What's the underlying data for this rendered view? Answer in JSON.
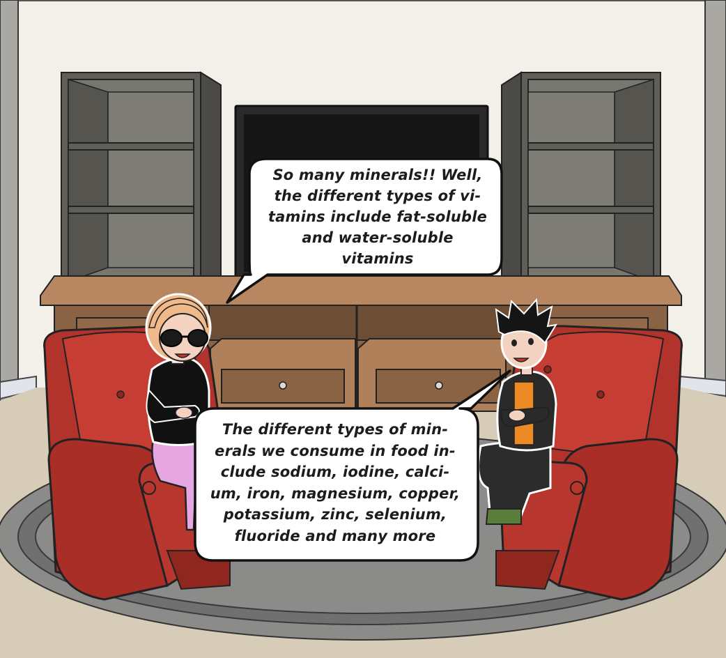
{
  "speech": {
    "top_bubble": {
      "speaker": "girl",
      "lines": [
        "So many minerals!! Well,",
        "the different types of vi-",
        "tamins include fat-soluble",
        "and water-soluble",
        "vitamins"
      ]
    },
    "bottom_bubble": {
      "speaker": "boy",
      "lines": [
        "The different types of min-",
        "erals we consume in food in-",
        "clude sodium, iodine, calci-",
        "um, iron, magnesium, copper,",
        "potassium, zinc, selenium,",
        "fluoride and many more"
      ]
    }
  },
  "colors": {
    "wall": "#f3f0ea",
    "floor": "#d8cdb8",
    "rug_outer": "#8a8a88",
    "rug_inner": "#6d6d6b",
    "armchair": "#b8342c",
    "shelf": "#5e5d58",
    "console": "#b4855f",
    "tv": "#1b1b1b"
  }
}
